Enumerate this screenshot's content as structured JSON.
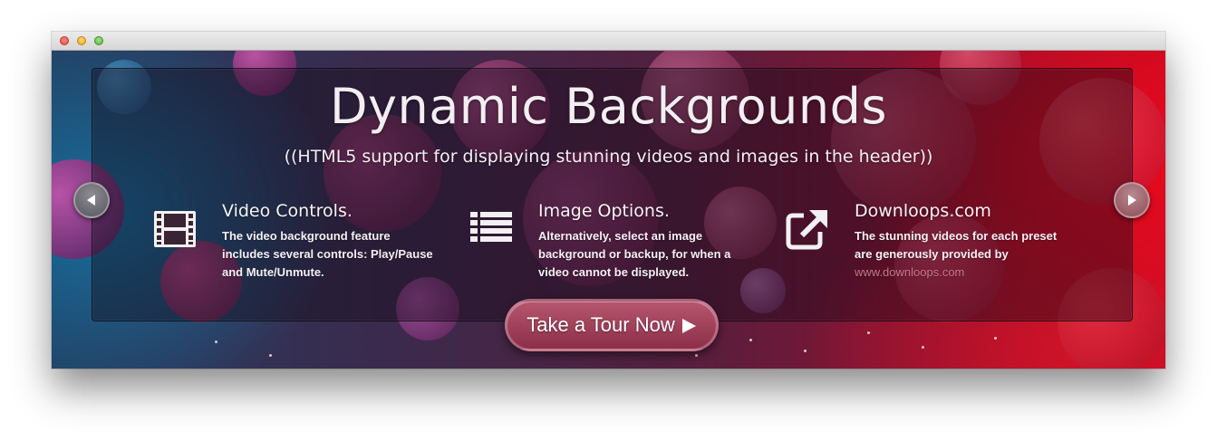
{
  "hero": {
    "title": "Dynamic Backgrounds",
    "subtitle": "((HTML5 support for displaying stunning videos and images in the header))"
  },
  "features": [
    {
      "icon": "film-icon",
      "heading": "Video Controls.",
      "body": "The video background feature includes several controls: Play/Pause and Mute/Unmute."
    },
    {
      "icon": "list-icon",
      "heading": "Image Options.",
      "body": "Alternatively, select an image background or backup, for when a video cannot be displayed."
    },
    {
      "icon": "external-link-icon",
      "heading": "Downloops.com",
      "body": "The stunning videos for each preset are generously provided by",
      "link": "www.downloops.com"
    }
  ],
  "cta": {
    "label": "Take a Tour Now",
    "icon": "play-icon"
  },
  "navigation": {
    "prev_icon": "chevron-left-icon",
    "next_icon": "chevron-right-icon"
  },
  "colors": {
    "accent": "#a2435c",
    "link": "#c57a8a",
    "background_left": "#233d5e",
    "background_right": "#c80820"
  }
}
